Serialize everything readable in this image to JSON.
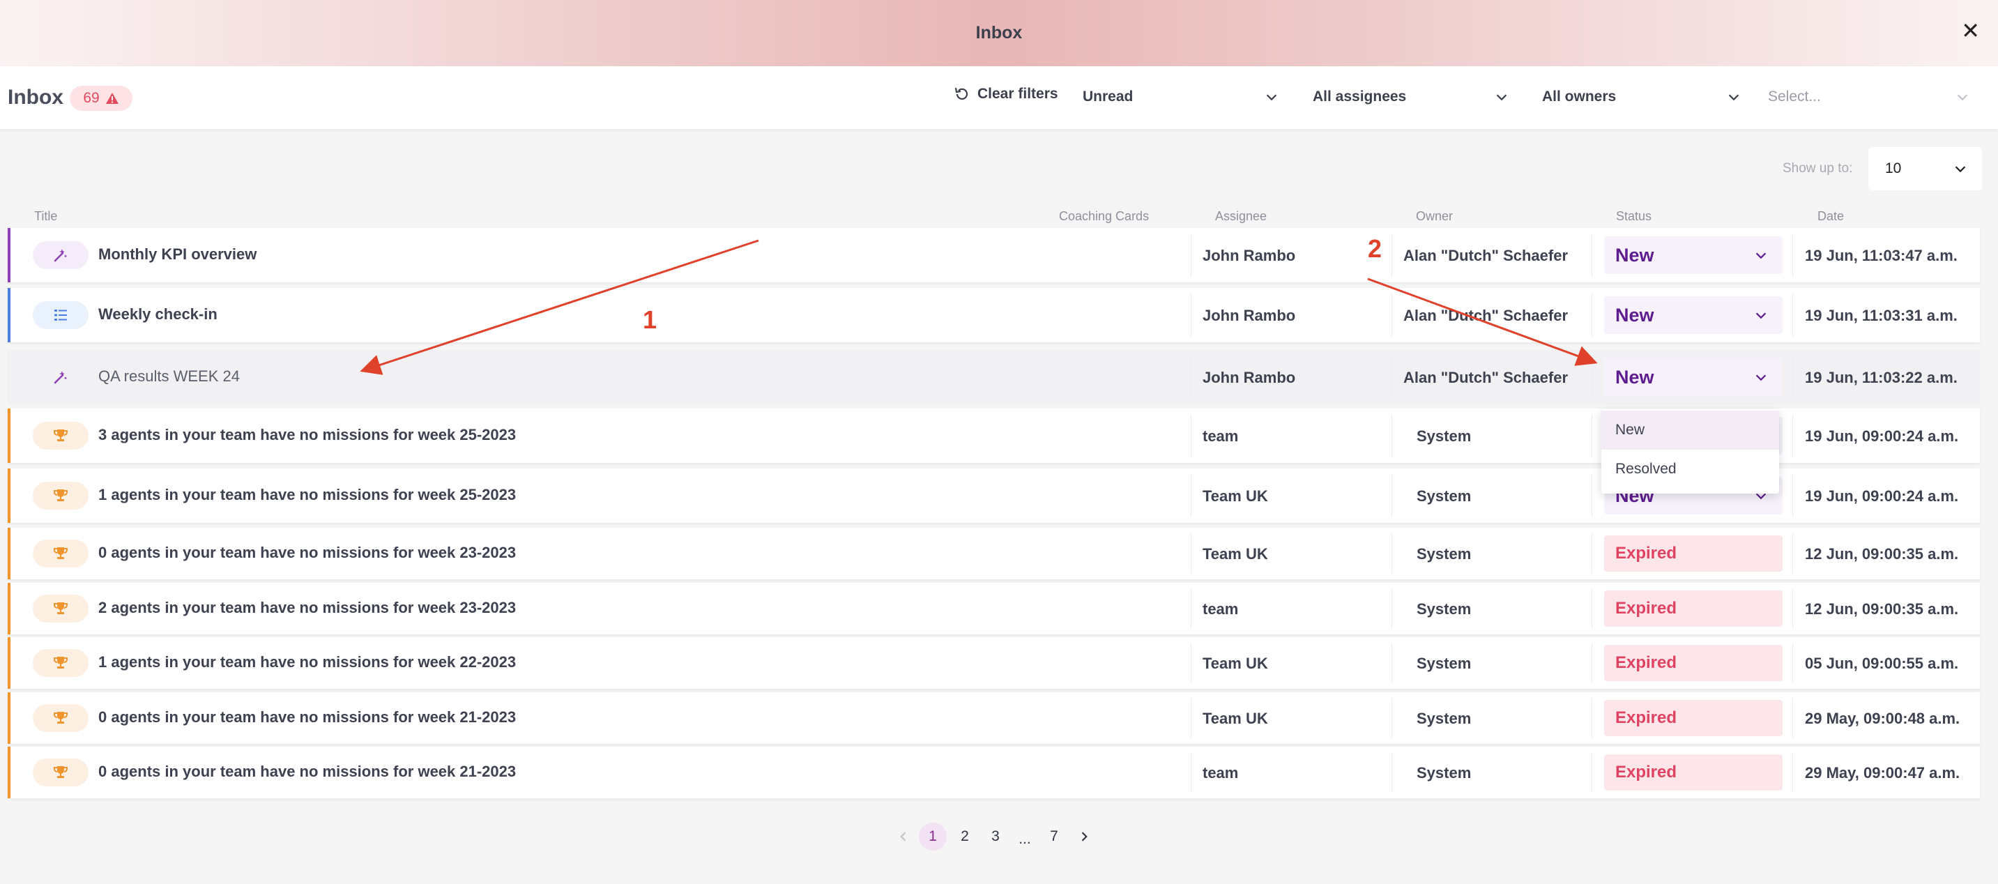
{
  "header": {
    "title": "Inbox",
    "close_icon": "close-icon"
  },
  "toolbar": {
    "inbox_label": "Inbox",
    "count": "69",
    "clear_filters": "Clear filters",
    "filters": {
      "read": "Unread",
      "assignees": "All assignees",
      "owners": "All owners",
      "select_placeholder": "Select..."
    }
  },
  "show": {
    "label": "Show up to:",
    "value": "10"
  },
  "columns": {
    "title": "Title",
    "coaching": "Coaching Cards",
    "assignee": "Assignee",
    "owner": "Owner",
    "status": "Status",
    "date": "Date"
  },
  "rows": [
    {
      "icon": "magic-wand-icon",
      "title": "Monthly KPI overview",
      "assignee": "John Rambo",
      "owner": "Alan \"Dutch\" Schaefer",
      "status": "New",
      "date": "19 Jun, 11:03:47 a.m."
    },
    {
      "icon": "checklist-icon",
      "title": "Weekly check-in",
      "assignee": "John Rambo",
      "owner": "Alan \"Dutch\" Schaefer",
      "status": "New",
      "date": "19 Jun, 11:03:31 a.m."
    },
    {
      "icon": "magic-wand-icon",
      "title": "QA results WEEK 24",
      "assignee": "John Rambo",
      "owner": "Alan \"Dutch\" Schaefer",
      "status": "New",
      "date": "19 Jun, 11:03:22 a.m."
    },
    {
      "icon": "trophy-icon",
      "title": "3 agents in your team have no missions for week 25-2023",
      "assignee": "team",
      "owner": "System",
      "status": "New",
      "date": "19 Jun, 09:00:24 a.m."
    },
    {
      "icon": "trophy-icon",
      "title": "1 agents in your team have no missions for week 25-2023",
      "assignee": "Team UK",
      "owner": "System",
      "status": "New",
      "date": "19 Jun, 09:00:24 a.m."
    },
    {
      "icon": "trophy-icon",
      "title": "0 agents in your team have no missions for week 23-2023",
      "assignee": "Team UK",
      "owner": "System",
      "status": "Expired",
      "date": "12 Jun, 09:00:35 a.m."
    },
    {
      "icon": "trophy-icon",
      "title": "2 agents in your team have no missions for week 23-2023",
      "assignee": "team",
      "owner": "System",
      "status": "Expired",
      "date": "12 Jun, 09:00:35 a.m."
    },
    {
      "icon": "trophy-icon",
      "title": "1 agents in your team have no missions for week 22-2023",
      "assignee": "Team UK",
      "owner": "System",
      "status": "Expired",
      "date": "05 Jun, 09:00:55 a.m."
    },
    {
      "icon": "trophy-icon",
      "title": "0 agents in your team have no missions for week 21-2023",
      "assignee": "Team UK",
      "owner": "System",
      "status": "Expired",
      "date": "29 May, 09:00:48 a.m."
    },
    {
      "icon": "trophy-icon",
      "title": "0 agents in your team have no missions for week 21-2023",
      "assignee": "team",
      "owner": "System",
      "status": "Expired",
      "date": "29 May, 09:00:47 a.m."
    }
  ],
  "status_dropdown": {
    "options": [
      "New",
      "Resolved"
    ]
  },
  "pagination": {
    "pages": [
      "1",
      "2",
      "3",
      "...",
      "7"
    ],
    "current": "1"
  },
  "annotations": {
    "one": "1",
    "two": "2"
  },
  "colors": {
    "purple_accent": "#8e3fb5",
    "blue_accent": "#4a7fe0",
    "orange_accent": "#f0952e",
    "new_status": "#5e1c8f",
    "expired_status": "#e04362",
    "annotation": "#e0412b"
  }
}
